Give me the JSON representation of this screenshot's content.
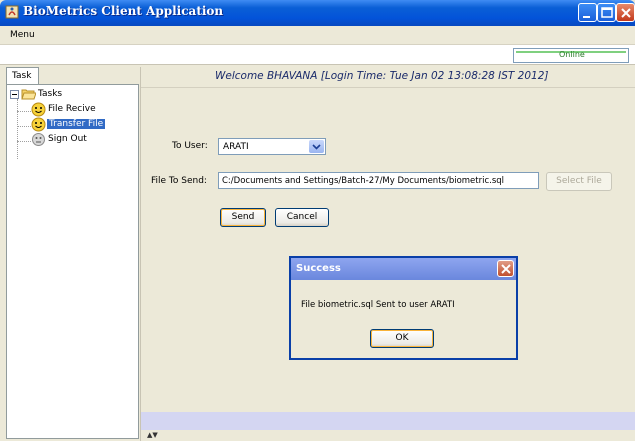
{
  "window": {
    "title": "BioMetrics Client Application"
  },
  "menubar": {
    "menu_label": "Menu"
  },
  "status": {
    "connection_text": "Online"
  },
  "left_panel": {
    "tab_label": "Task",
    "tree": {
      "root_label": "Tasks",
      "items": [
        {
          "label": "File Recive"
        },
        {
          "label": "Transfer File",
          "selected": true
        },
        {
          "label": "Sign Out"
        }
      ]
    }
  },
  "main": {
    "welcome_text": "Welcome BHAVANA [Login Time: Tue Jan 02 13:08:28 IST 2012]",
    "to_user_label": "To User:",
    "to_user_value": "ARATI",
    "file_label": "File To Send:",
    "file_value": "C:/Documents and Settings/Batch-27/My Documents/biometric.sql",
    "select_file_label": "Select File",
    "send_label": "Send",
    "cancel_label": "Cancel"
  },
  "dialog": {
    "title": "Success",
    "message": "File biometric.sql Sent to user ARATI",
    "ok_label": "OK"
  },
  "colors": {
    "title_bar": "#0353d9",
    "selection": "#316ac5",
    "dialog_title": "#7a94e4"
  }
}
